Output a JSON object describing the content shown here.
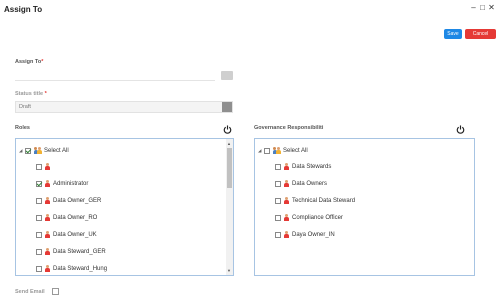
{
  "window": {
    "title": "Assign To",
    "controls": [
      "–",
      "□",
      "✕"
    ]
  },
  "toolbar": {
    "save_label": "Save",
    "cancel_label": "Cancel"
  },
  "form": {
    "assign_to_label": "Assign To",
    "required_mark": "*",
    "status_title_label": "Status title",
    "status_value": "Draft",
    "roles_label": "Roles",
    "governance_label": "Governance Responsibiliti",
    "send_email_label": "Send Email"
  },
  "roles_tree": {
    "select_all": {
      "label": "Select All",
      "checked": true
    },
    "items": [
      {
        "label": "",
        "checked": false
      },
      {
        "label": "Administrator",
        "checked": true
      },
      {
        "label": "Data Owner_GER",
        "checked": false
      },
      {
        "label": "Data Owner_RO",
        "checked": false
      },
      {
        "label": "Data Owner_UK",
        "checked": false
      },
      {
        "label": "Data Steward_GER",
        "checked": false
      },
      {
        "label": "Data Steward_Hung",
        "checked": false
      }
    ]
  },
  "governance_tree": {
    "select_all": {
      "label": "Select All",
      "checked": false
    },
    "items": [
      {
        "label": "Data Stewards",
        "checked": false
      },
      {
        "label": "Data Owners",
        "checked": false
      },
      {
        "label": "Technical Data Steward",
        "checked": false
      },
      {
        "label": "Compliance Officer",
        "checked": false
      },
      {
        "label": "Daya Owner_IN",
        "checked": false
      }
    ]
  },
  "icons": {
    "power": "power-icon",
    "user": "user-icon",
    "group": "group-icon",
    "expand": "triangle-down-icon"
  },
  "colors": {
    "save": "#1e88e5",
    "cancel": "#e53935",
    "required": "#e53935",
    "panel_border": "#a7c4e3"
  }
}
